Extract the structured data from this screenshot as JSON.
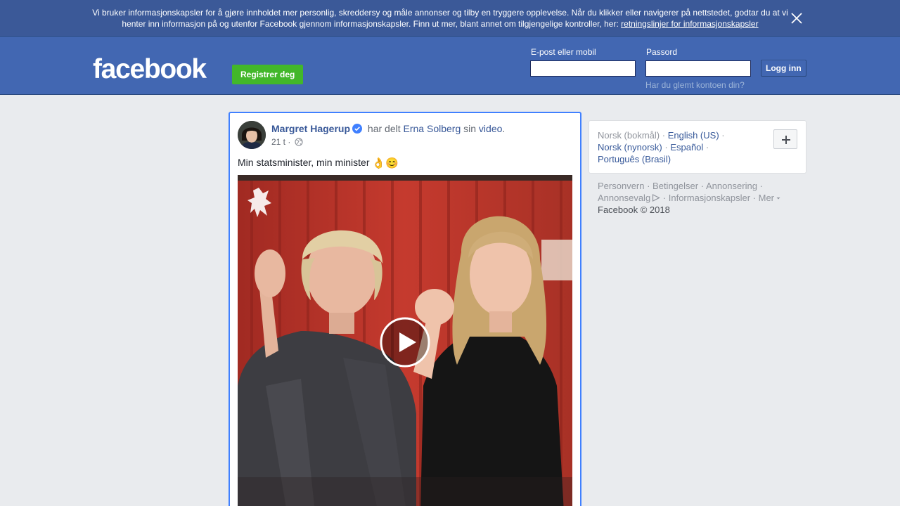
{
  "cookie_banner": {
    "text": "Vi bruker informasjonskapsler for å gjøre innholdet mer personlig, skreddersy og måle annonser og tilby en tryggere opplevelse. Når du klikker eller navigerer på nettstedet, godtar du at vi henter inn informasjon på og utenfor Facebook gjennom informasjonskapsler. Finn ut mer, blant annet om tilgjengelige kontroller, her: ",
    "link": "retningslinjer for informasjonskapsler"
  },
  "header": {
    "logo": "facebook",
    "register_label": "Registrer deg",
    "email_label": "E-post eller mobil",
    "password_label": "Passord",
    "login_label": "Logg inn",
    "forgot_label": "Har du glemt kontoen din?",
    "email_value": "",
    "password_value": ""
  },
  "post": {
    "author": "Margret Hagerup",
    "shared_text": "har delt",
    "shared_from": "Erna Solberg",
    "sin_text": "sin",
    "object_link": "video",
    "object_suffix": ".",
    "time": "21 t",
    "meta_sep": "·",
    "text": "Min statsminister, min minister",
    "emoji1": "👌",
    "emoji2": "😊"
  },
  "languages": {
    "items": [
      "Norsk (bokmål)",
      "English (US)",
      "Norsk (nynorsk)",
      "Español",
      "Português (Brasil)"
    ],
    "separator": " · "
  },
  "footer": {
    "links": [
      "Personvern",
      "Betingelser",
      "Annonsering",
      "Annonsevalg",
      "Informasjonskapsler",
      "Mer"
    ],
    "separator": " · ",
    "copyright": "Facebook © 2018"
  },
  "colors": {
    "brand_blue": "#4267b2",
    "banner_blue": "#3b5998",
    "register_green": "#42b72a",
    "link_blue": "#385898",
    "focus_border": "#4080ff"
  }
}
